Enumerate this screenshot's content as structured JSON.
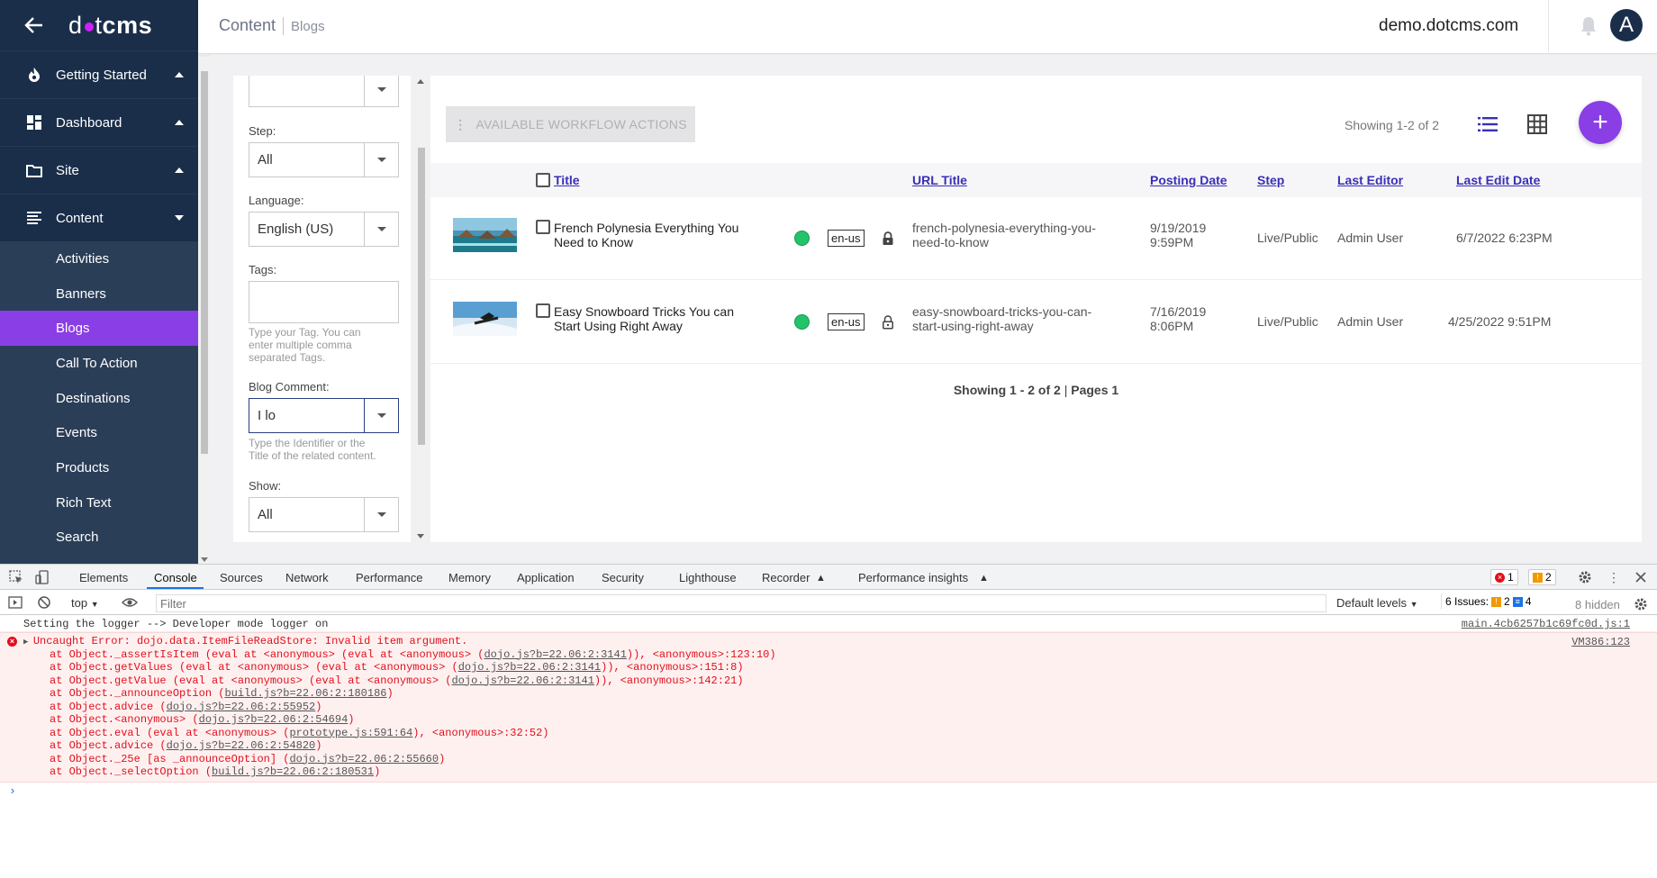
{
  "sidebar": {
    "logo_light": "d",
    "logo_tail": "t",
    "logo_bold": "cms",
    "groups": [
      {
        "label": "Getting Started",
        "icon": "fire-icon",
        "expanded": false
      },
      {
        "label": "Dashboard",
        "icon": "dashboard-icon",
        "expanded": false
      },
      {
        "label": "Site",
        "icon": "folder-icon",
        "expanded": false
      },
      {
        "label": "Content",
        "icon": "content-lines-icon",
        "expanded": true
      }
    ],
    "content_items": [
      "Activities",
      "Banners",
      "Blogs",
      "Call To Action",
      "Destinations",
      "Events",
      "Products",
      "Rich Text",
      "Search"
    ],
    "active_item": "Blogs"
  },
  "topbar": {
    "breadcrumb_root": "Content",
    "breadcrumb_current": "Blogs",
    "site": "demo.dotcms.com",
    "avatar_letter": "A"
  },
  "filters": {
    "top_select_value": "",
    "step_label": "Step:",
    "step_value": "All",
    "language_label": "Language:",
    "language_value": "English (US)",
    "tags_label": "Tags:",
    "tags_hint": "Type your Tag. You can enter multiple comma separated Tags.",
    "comment_label": "Blog Comment:",
    "comment_value": "I lo",
    "comment_hint": "Type the Identifier or the Title of the related content.",
    "show_label": "Show:",
    "show_value": "All"
  },
  "results": {
    "workflow_button": "AVAILABLE WORKFLOW ACTIONS",
    "showing_top": "Showing 1-2 of 2",
    "columns": [
      "Title",
      "URL Title",
      "Posting Date",
      "Step",
      "Last Editor",
      "Last Edit Date"
    ],
    "rows": [
      {
        "title": "French Polynesia Everything You Need to Know",
        "lang": "en-us",
        "url_title": "french-polynesia-everything-you-need-to-know",
        "posting_date": "9/19/2019 9:59PM",
        "step": "Live/Public",
        "editor": "Admin User",
        "edit_date": "6/7/2022 6:23PM",
        "locked": true
      },
      {
        "title": "Easy Snowboard Tricks You can Start Using Right Away",
        "lang": "en-us",
        "url_title": "easy-snowboard-tricks-you-can-start-using-right-away",
        "posting_date": "7/16/2019 8:06PM",
        "step": "Live/Public",
        "editor": "Admin User",
        "edit_date": "4/25/2022 9:51PM",
        "locked": false
      }
    ],
    "pager_showing": "Showing 1 - 2 of 2",
    "pager_pages": "Pages 1"
  },
  "colors": {
    "sidebar_bg": "#2b3e58",
    "accent_purple": "#8a3ee5",
    "status_green": "#23c36a",
    "link_blue": "#3a2fb6",
    "error_red": "#e0101b"
  },
  "devtools": {
    "tabs": [
      "Elements",
      "Console",
      "Sources",
      "Network",
      "Performance",
      "Memory",
      "Application",
      "Security",
      "Lighthouse",
      "Recorder",
      "Performance insights"
    ],
    "active_tab": "Console",
    "error_count": "1",
    "warning_count": "2",
    "context": "top",
    "filter_placeholder": "Filter",
    "levels": "Default levels",
    "issues_label": "6 Issues:",
    "issues_warn": "2",
    "issues_info": "4",
    "hidden": "8 hidden",
    "log_line": "Setting the logger --> Developer mode logger on",
    "log_src": "main.4cb6257b1c69fc0d.js:1",
    "error_src": "VM386:123",
    "error_lines": [
      {
        "pre": "Uncaught Error: dojo.data.ItemFileReadStore: Invalid item argument.",
        "link": "",
        "post": ""
      },
      {
        "pre": "at Object._assertIsItem (eval at <anonymous> (eval at <anonymous> (",
        "link": "dojo.js?b=22.06:2:3141",
        "post": ")), <anonymous>:123:10)"
      },
      {
        "pre": "at Object.getValues (eval at <anonymous> (eval at <anonymous> (",
        "link": "dojo.js?b=22.06:2:3141",
        "post": ")), <anonymous>:151:8)"
      },
      {
        "pre": "at Object.getValue (eval at <anonymous> (eval at <anonymous> (",
        "link": "dojo.js?b=22.06:2:3141",
        "post": ")), <anonymous>:142:21)"
      },
      {
        "pre": "at Object._announceOption (",
        "link": "build.js?b=22.06:2:180186",
        "post": ")"
      },
      {
        "pre": "at Object.advice (",
        "link": "dojo.js?b=22.06:2:55952",
        "post": ")"
      },
      {
        "pre": "at Object.<anonymous> (",
        "link": "dojo.js?b=22.06:2:54694",
        "post": ")"
      },
      {
        "pre": "at Object.eval (eval at <anonymous> (",
        "link": "prototype.js:591:64",
        "post": "), <anonymous>:32:52)"
      },
      {
        "pre": "at Object.advice (",
        "link": "dojo.js?b=22.06:2:54820",
        "post": ")"
      },
      {
        "pre": "at Object._25e [as _announceOption] (",
        "link": "dojo.js?b=22.06:2:55660",
        "post": ")"
      },
      {
        "pre": "at Object._selectOption (",
        "link": "build.js?b=22.06:2:180531",
        "post": ")"
      }
    ]
  }
}
